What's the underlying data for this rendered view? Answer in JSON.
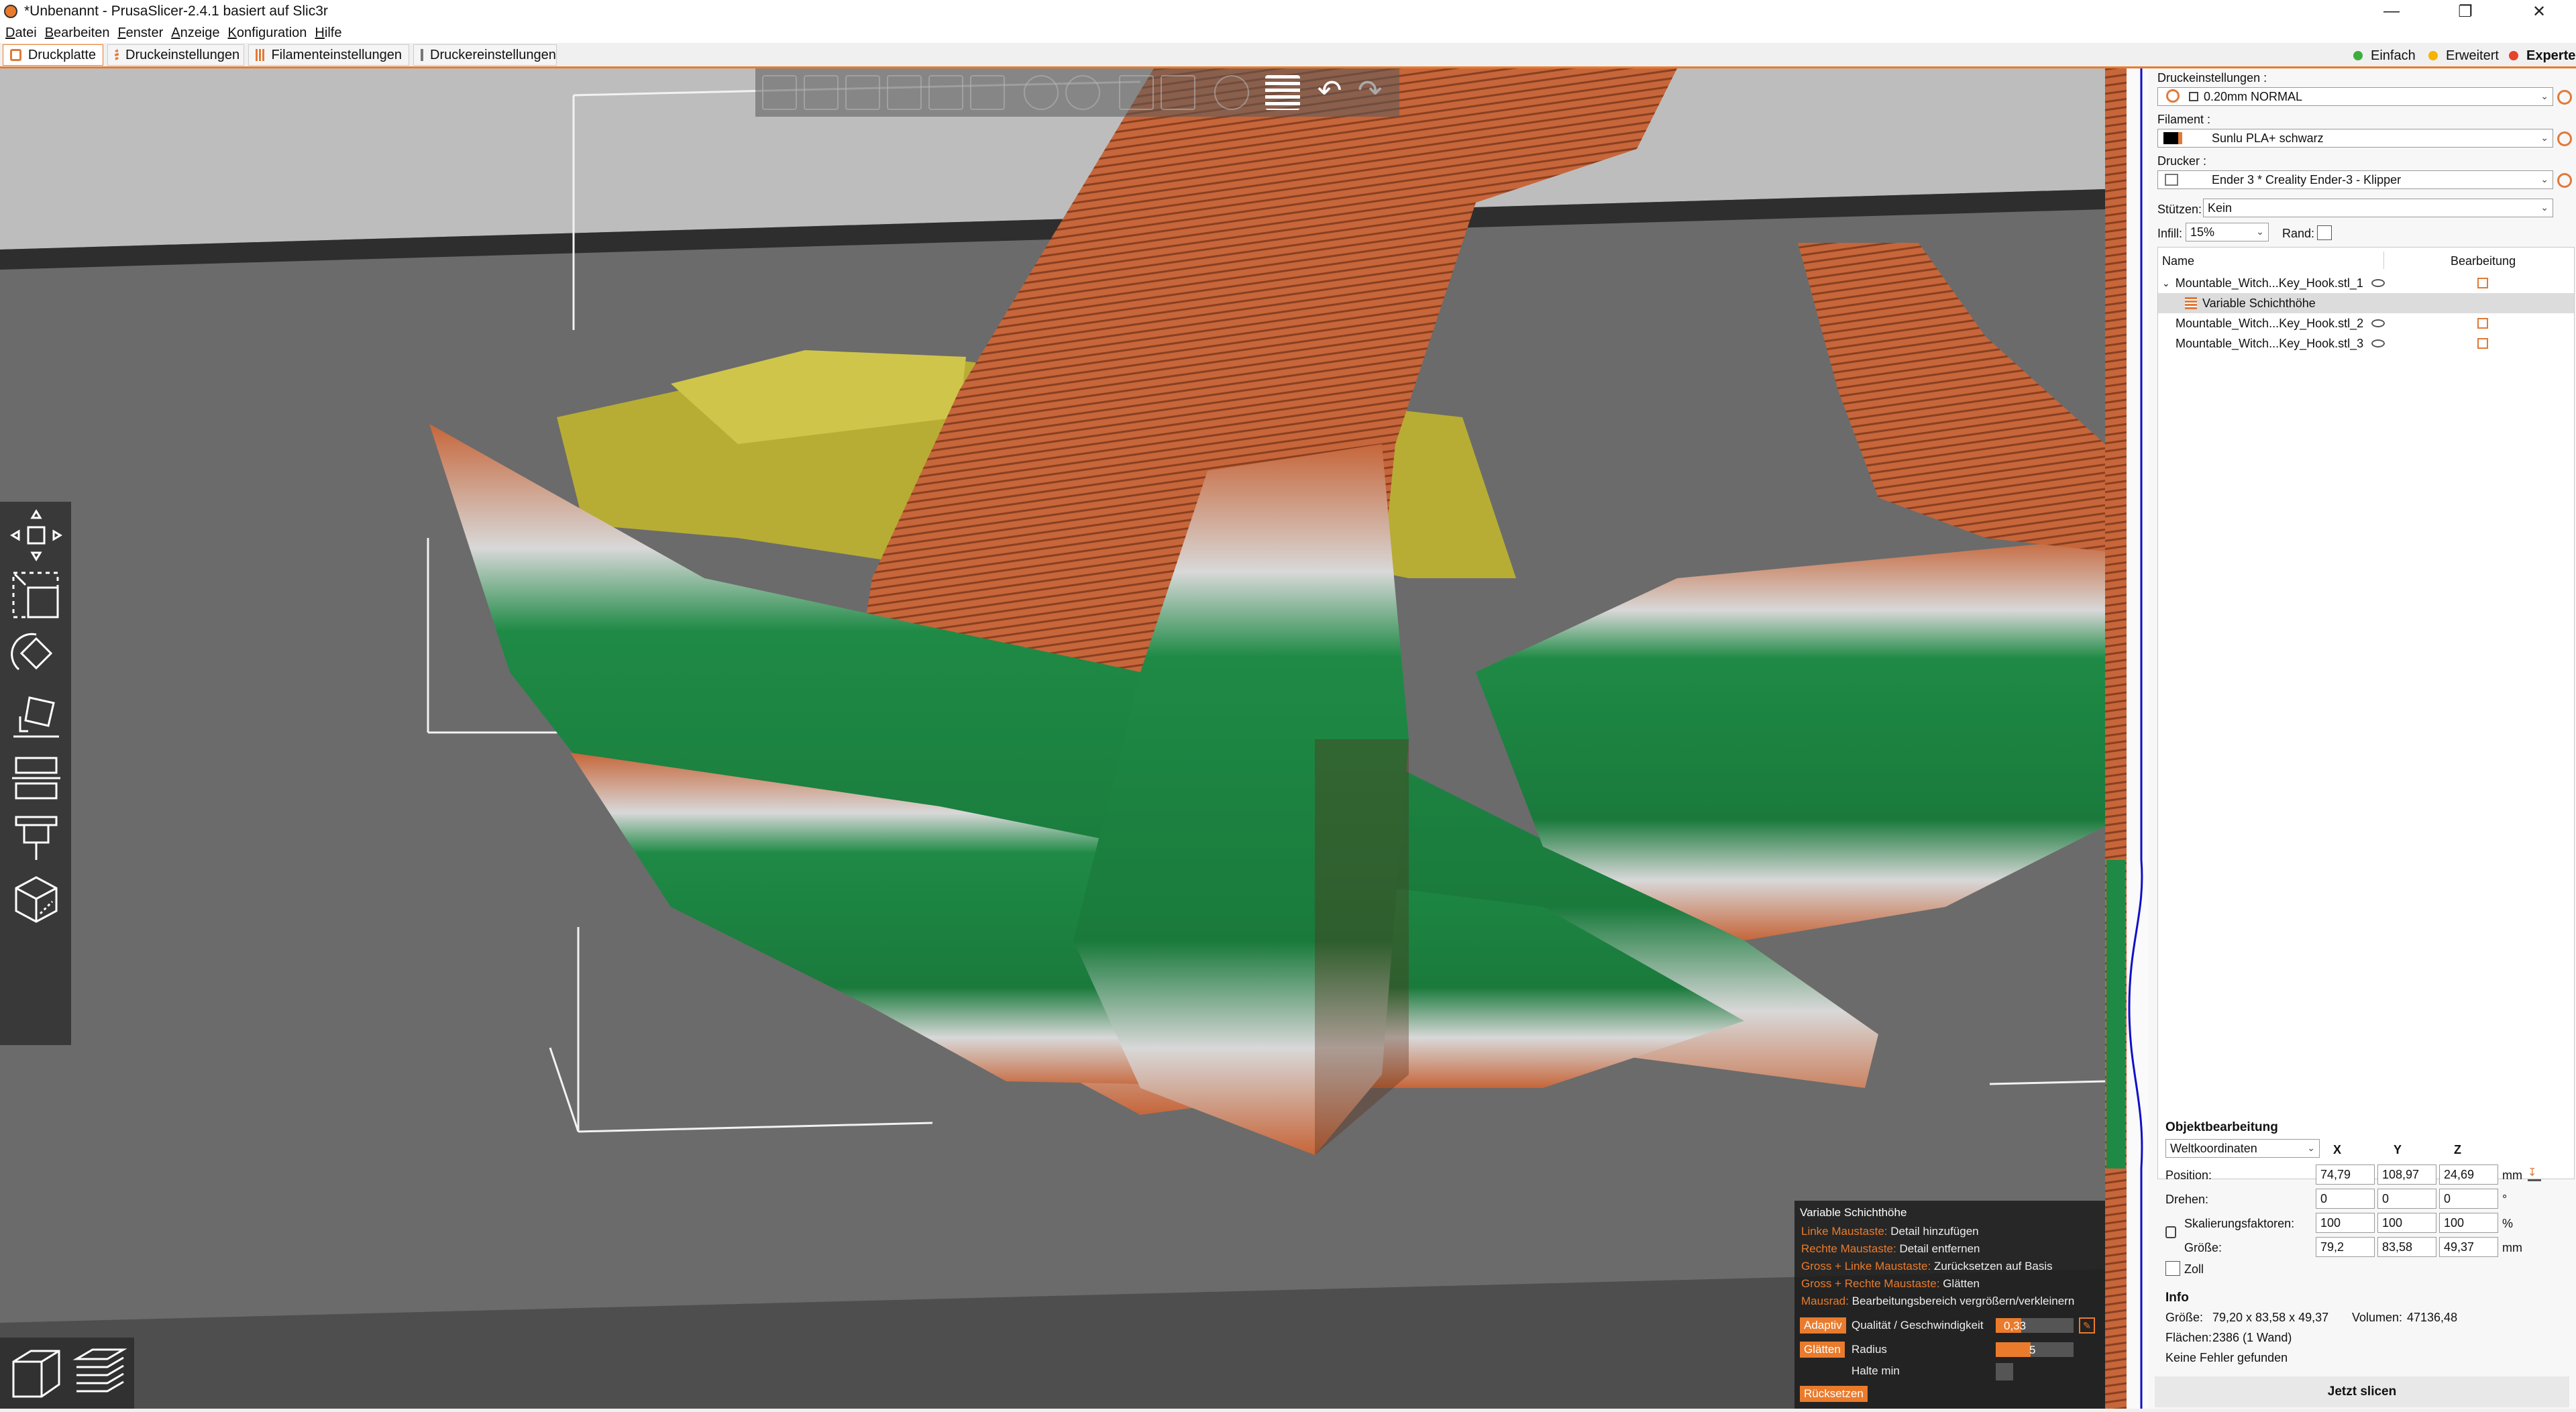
{
  "window": {
    "title": "*Unbenannt - PrusaSlicer-2.4.1 basiert auf Slic3r"
  },
  "menu": [
    "Datei",
    "Bearbeiten",
    "Fenster",
    "Anzeige",
    "Konfiguration",
    "Hilfe"
  ],
  "tabs": [
    "Druckplatte",
    "Druckeinstellungen",
    "Filamenteinstellungen",
    "Druckereinstellungen"
  ],
  "modes": [
    {
      "label": "Einfach",
      "color": "#3dae3d"
    },
    {
      "label": "Erweitert",
      "color": "#f5b400"
    },
    {
      "label": "Experte",
      "color": "#e8432a"
    }
  ],
  "settings": {
    "print_label": "Druckeinstellungen :",
    "print_value": "0.20mm NORMAL",
    "filament_label": "Filament :",
    "filament_value": "Sunlu PLA+ schwarz",
    "printer_label": "Drucker :",
    "printer_value": "Ender 3 * Creality Ender-3 - Klipper",
    "supports_label": "Stützen:",
    "supports_value": "Kein",
    "infill_label": "Infill:",
    "infill_value": "15%",
    "brim_label": "Rand:"
  },
  "objects": {
    "col_name": "Name",
    "col_edit": "Bearbeitung",
    "items": [
      {
        "name": "Mountable_Witch...Key_Hook.stl_1"
      },
      {
        "name": "Variable Schichthöhe"
      },
      {
        "name": "Mountable_Witch...Key_Hook.stl_2"
      },
      {
        "name": "Mountable_Witch...Key_Hook.stl_3"
      }
    ]
  },
  "object_edit": {
    "title": "Objektbearbeitung",
    "coords": "Weltkoordinaten",
    "axes": [
      "X",
      "Y",
      "Z"
    ],
    "position_label": "Position:",
    "position": [
      "74,79",
      "108,97",
      "24,69"
    ],
    "position_unit": "mm",
    "rotate_label": "Drehen:",
    "rotate": [
      "0",
      "0",
      "0"
    ],
    "rotate_unit": "°",
    "scale_label": "Skalierungsfaktoren:",
    "scale": [
      "100",
      "100",
      "100"
    ],
    "scale_unit": "%",
    "size_label": "Größe:",
    "size": [
      "79,2",
      "83,58",
      "49,37"
    ],
    "size_unit": "mm",
    "inch_label": "Zoll"
  },
  "info": {
    "title": "Info",
    "size_label": "Größe:",
    "size_value": "79,20 x 83,58 x 49,37",
    "volume_label": "Volumen:",
    "volume_value": "47136,48",
    "faces_label": "Flächen:",
    "faces_value": "2386 (1 Wand)",
    "errors": "Keine Fehler gefunden"
  },
  "slice_button": "Jetzt slicen",
  "variable_layer": {
    "title": "Variable Schichthöhe",
    "hints": [
      {
        "key": "Linke Maustaste:",
        "action": "Detail hinzufügen"
      },
      {
        "key": "Rechte Maustaste:",
        "action": "Detail entfernen"
      },
      {
        "key": "Gross + Linke Maustaste:",
        "action": "Zurücksetzen auf Basis"
      },
      {
        "key": "Gross + Rechte Maustaste:",
        "action": "Glätten"
      },
      {
        "key": "Mausrad:",
        "action": "Bearbeitungsbereich vergrößern/verkleinern"
      }
    ],
    "adaptive_button": "Adaptiv",
    "quality_label": "Qualität / Geschwindigkeit",
    "quality_value": "0,33",
    "quality_fraction": 0.33,
    "smooth_button": "Glätten",
    "radius_label": "Radius",
    "radius_value": "5",
    "radius_fraction": 0.45,
    "keep_min_label": "Halte min",
    "reset_button": "Rücksetzen"
  }
}
